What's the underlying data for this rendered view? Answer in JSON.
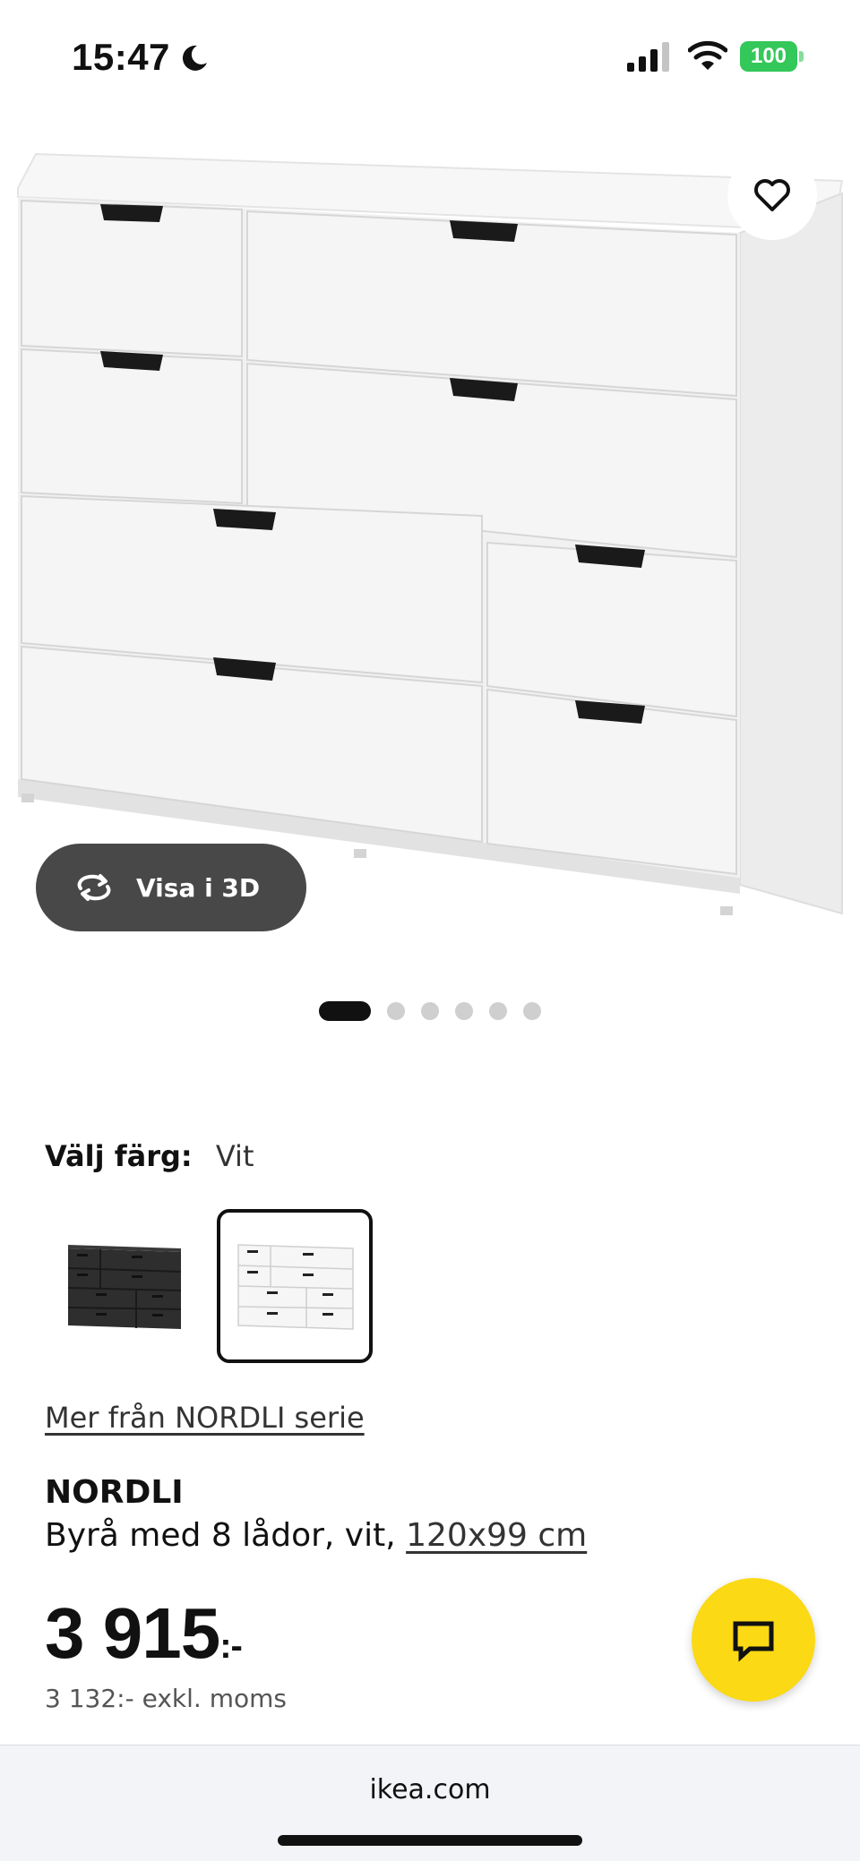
{
  "status_bar": {
    "time": "15:47",
    "battery": "100"
  },
  "product_gallery": {
    "view_3d_label": "Visa i 3D",
    "slide_count": 6,
    "active_slide": 1
  },
  "color_selector": {
    "label": "Välj färg:",
    "selected_value": "Vit",
    "options": [
      "black",
      "white"
    ]
  },
  "series_link": "Mer från NORDLI serie",
  "product": {
    "brand": "NORDLI",
    "description": "Byrå med 8 lådor, vit, ",
    "size": "120x99 cm",
    "price": "3 915",
    "price_suffix": ":-",
    "price_ex_vat": "3 132:- exkl. moms"
  },
  "browser": {
    "url": "ikea.com"
  },
  "colors": {
    "accent_yellow": "#fbd914",
    "battery_green": "#34c759",
    "button_dark": "#484848"
  }
}
